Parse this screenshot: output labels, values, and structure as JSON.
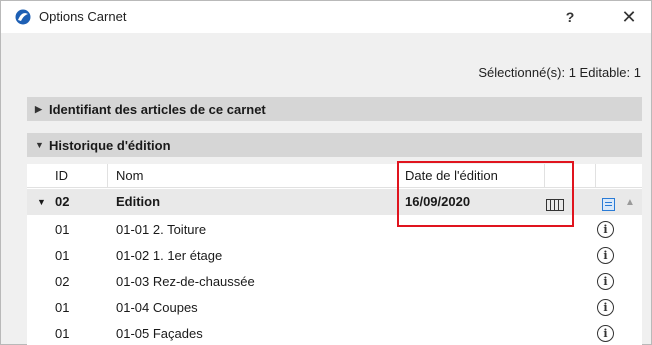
{
  "window": {
    "title": "Options Carnet",
    "help_label": "?",
    "close_label": "✕"
  },
  "selection_status": "Sélectionné(s): 1 Editable: 1",
  "sections": {
    "identifier": {
      "label": "Identifiant des articles de ce carnet",
      "expanded": false
    },
    "history": {
      "label": "Historique d'édition",
      "expanded": true
    }
  },
  "table": {
    "columns": {
      "id": "ID",
      "name": "Nom",
      "date": "Date de l'édition"
    },
    "group_row": {
      "id": "02",
      "name": "Edition",
      "date": "16/09/2020"
    },
    "rows": [
      {
        "id": "01",
        "name": "01-01 2. Toiture"
      },
      {
        "id": "01",
        "name": "01-02 1. 1er étage"
      },
      {
        "id": "02",
        "name": "01-03 Rez-de-chaussée"
      },
      {
        "id": "01",
        "name": "01-04 Coupes"
      },
      {
        "id": "01",
        "name": "01-05 Façades"
      }
    ]
  },
  "colors": {
    "highlight": "#e0141e",
    "accent": "#2a7bd6",
    "section_bg": "#d6d6d6"
  },
  "icons": {
    "app": "archicad-icon",
    "info": "info-icon",
    "calendar": "calendar-icon",
    "list": "list-icon"
  }
}
